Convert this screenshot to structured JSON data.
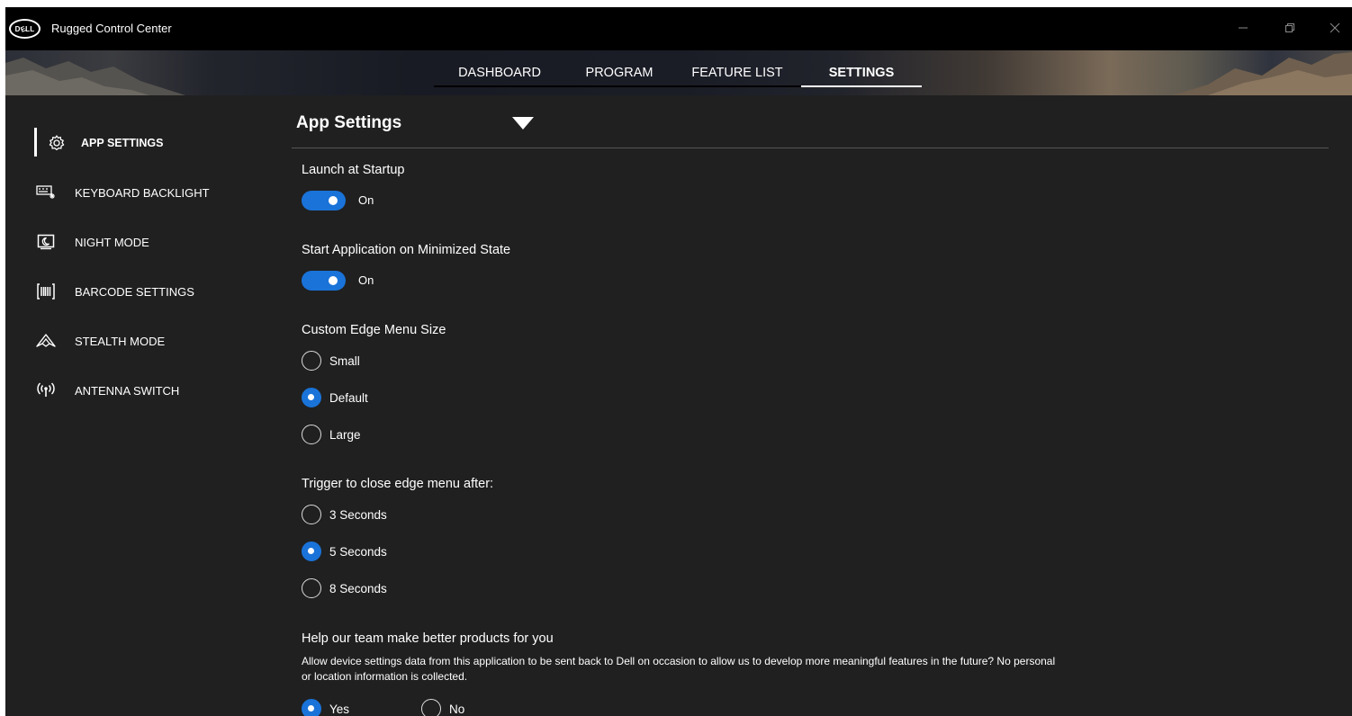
{
  "window": {
    "title": "Rugged Control Center",
    "logo_text": "DɆLL",
    "controls": [
      "minimize-icon",
      "restore-icon",
      "close-icon"
    ]
  },
  "nav": {
    "tabs": [
      {
        "label": "DASHBOARD",
        "active": false
      },
      {
        "label": "PROGRAM",
        "active": false
      },
      {
        "label": "FEATURE LIST",
        "active": false
      },
      {
        "label": "SETTINGS",
        "active": true
      }
    ]
  },
  "sidebar": {
    "items": [
      {
        "label": "APP SETTINGS",
        "icon": "gear-icon",
        "active": true
      },
      {
        "label": "KEYBOARD BACKLIGHT",
        "icon": "keyboard-backlight-icon",
        "active": false
      },
      {
        "label": "NIGHT MODE",
        "icon": "night-mode-icon",
        "active": false
      },
      {
        "label": "BARCODE SETTINGS",
        "icon": "barcode-icon",
        "active": false
      },
      {
        "label": "STEALTH MODE",
        "icon": "stealth-icon",
        "active": false
      },
      {
        "label": "ANTENNA SWITCH",
        "icon": "antenna-icon",
        "active": false
      }
    ]
  },
  "main": {
    "title": "App Settings",
    "launch_at_startup": {
      "label": "Launch at Startup",
      "state": "On"
    },
    "start_minimized": {
      "label": "Start Application on Minimized State",
      "state": "On"
    },
    "edge_menu_size": {
      "label": "Custom Edge Menu Size",
      "options": [
        "Small",
        "Default",
        "Large"
      ],
      "selected": "Default"
    },
    "close_trigger": {
      "label": "Trigger to close edge menu after:",
      "options": [
        "3 Seconds",
        "5 Seconds",
        "8 Seconds"
      ],
      "selected": "5 Seconds"
    },
    "feedback": {
      "label": "Help our team make better products for you",
      "description": "Allow device settings data from this application to be sent back to Dell on occasion to allow us to develop more meaningful features in the future? No personal or location information is collected.",
      "options": [
        "Yes",
        "No"
      ],
      "selected": "Yes"
    }
  },
  "colors": {
    "accent": "#1a73d8",
    "background": "#202020",
    "titlebar": "#000000"
  }
}
